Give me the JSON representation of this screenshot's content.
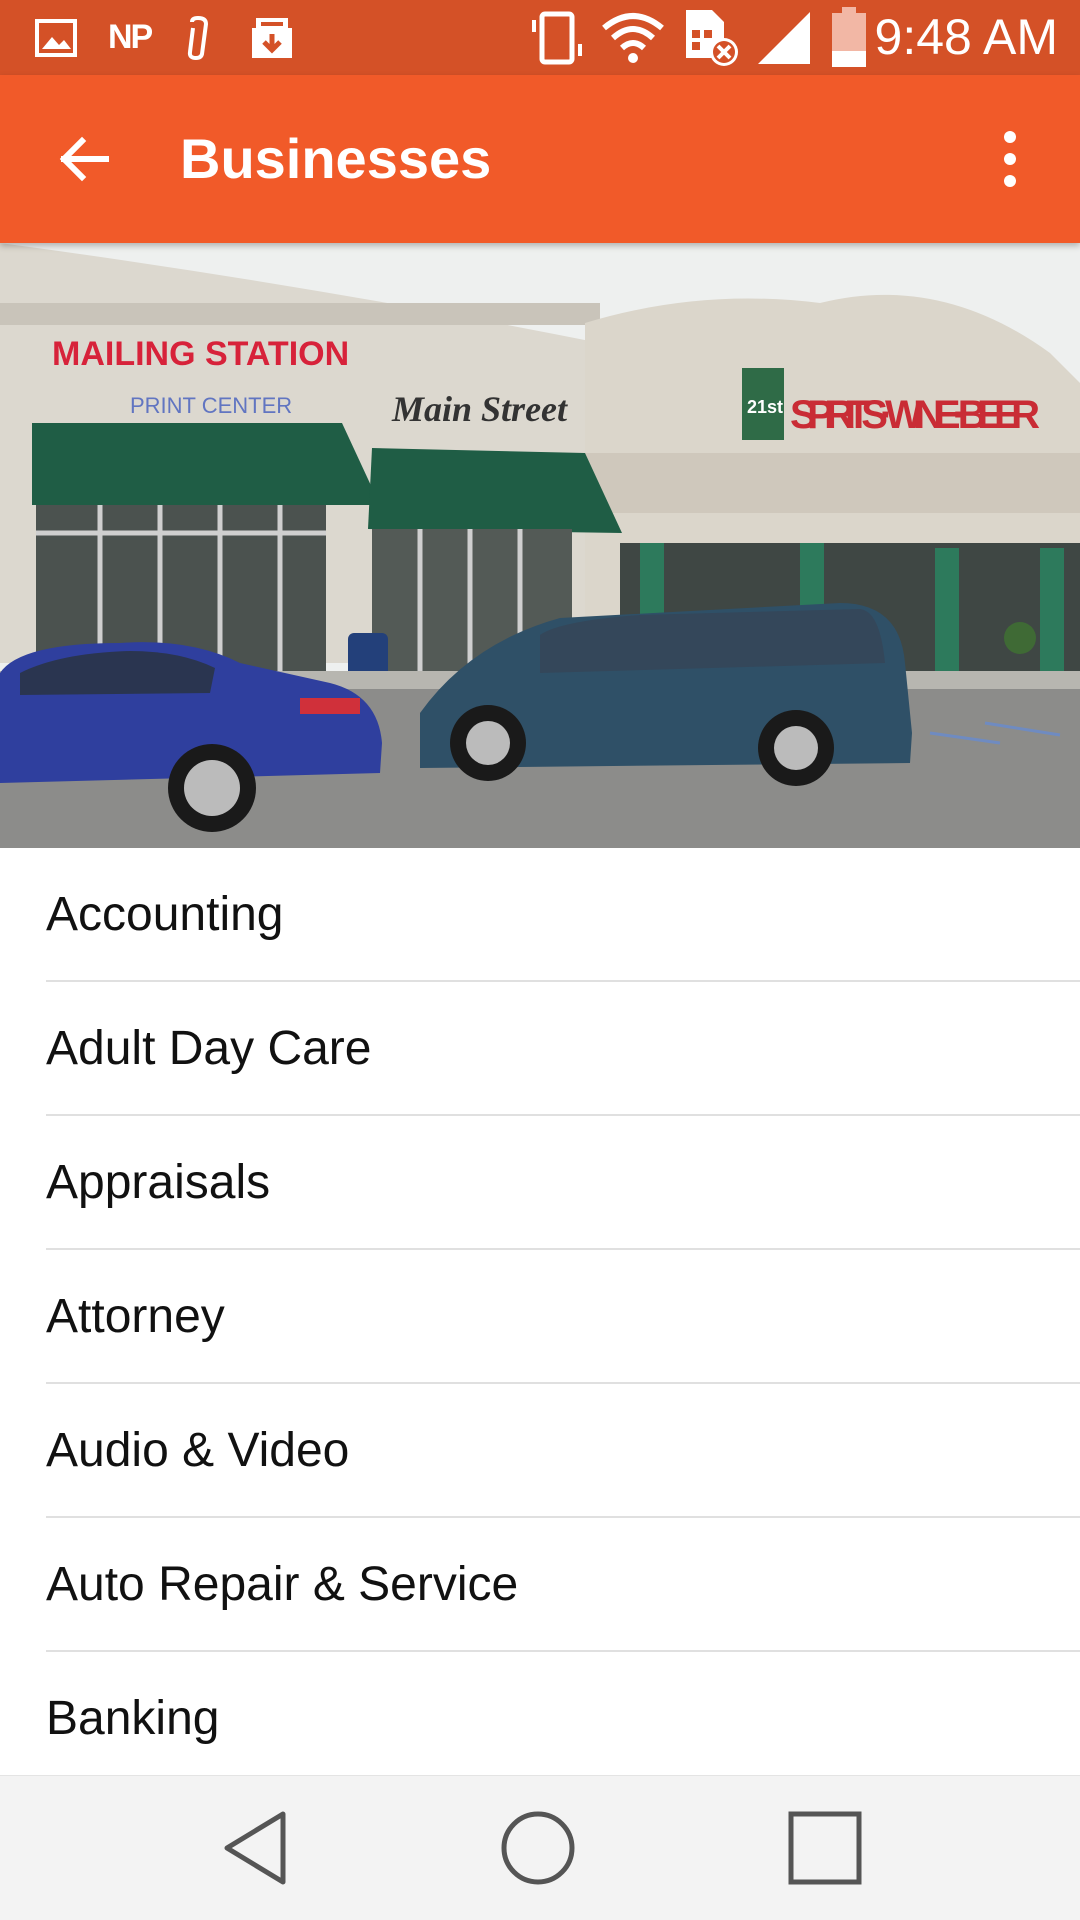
{
  "status_bar": {
    "time": "9:48 AM",
    "np_text": "NP",
    "icons": [
      "image-icon",
      "np-icon",
      "clip-icon",
      "download-box-icon",
      "vibrate-icon",
      "wifi-icon",
      "sim-error-icon",
      "signal-icon",
      "battery-icon"
    ],
    "background": "#d45127"
  },
  "app_bar": {
    "title": "Businesses",
    "back_icon": "back-arrow-icon",
    "menu_icon": "more-vert-icon",
    "background": "#f15a29"
  },
  "hero": {
    "signs": {
      "mailing": "MAILING STATION",
      "mailing_sub": "PRINT CENTER",
      "main_street": "Main Street",
      "spirits": "SPIRITS · WINE · BEER",
      "spirits_logo": "21st"
    }
  },
  "categories": [
    "Accounting",
    "Adult Day Care",
    "Appraisals",
    "Attorney",
    "Audio & Video",
    "Auto Repair & Service",
    "Banking"
  ],
  "nav_bar": {
    "icons": [
      "nav-back-icon",
      "nav-home-icon",
      "nav-recents-icon"
    ]
  }
}
